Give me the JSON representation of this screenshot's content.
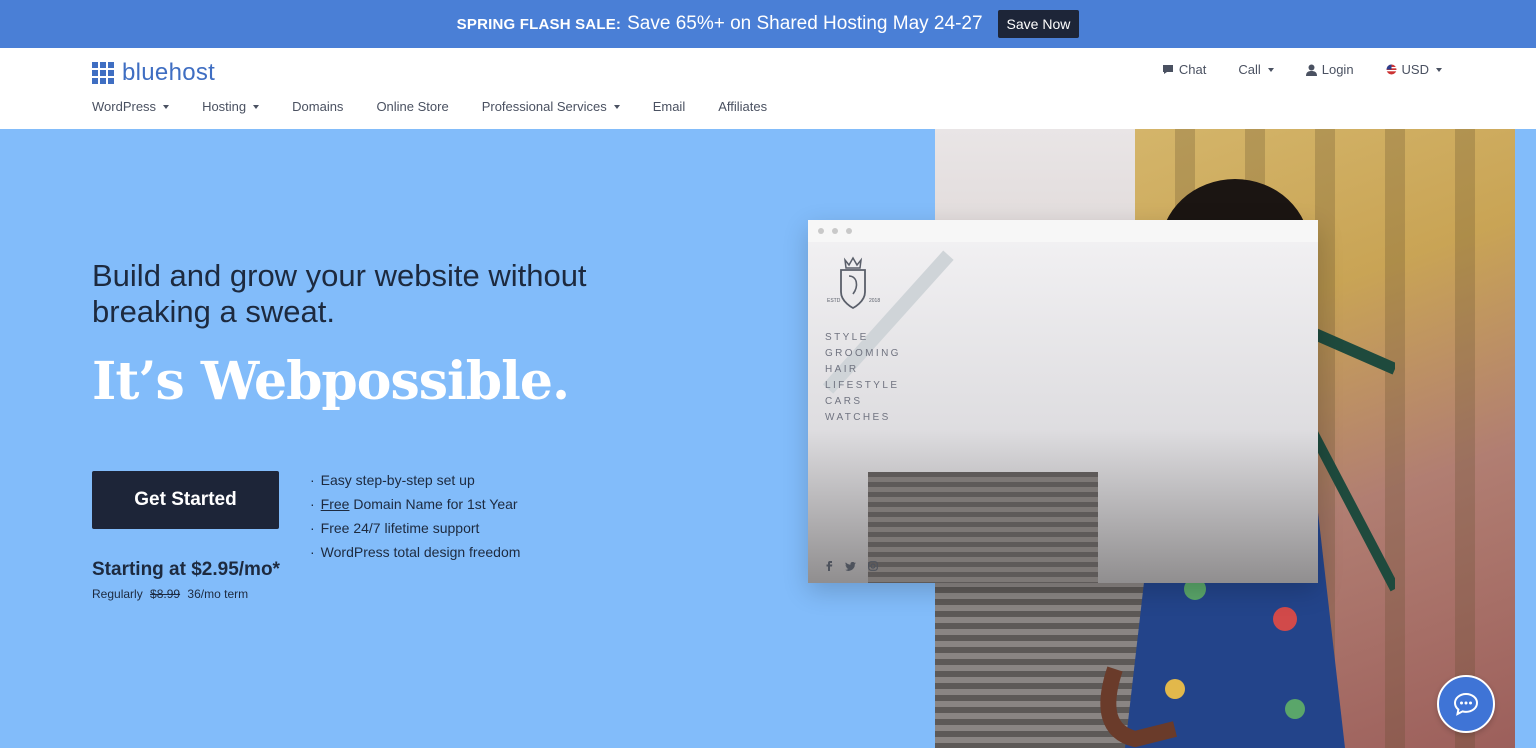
{
  "promo": {
    "lead": "SPRING FLASH SALE:",
    "offer": "Save 65%+ on Shared Hosting May 24-27",
    "button": "Save Now"
  },
  "header": {
    "brand": "bluehost",
    "nav": [
      {
        "label": "WordPress",
        "dropdown": true
      },
      {
        "label": "Hosting",
        "dropdown": true
      },
      {
        "label": "Domains",
        "dropdown": false
      },
      {
        "label": "Online Store",
        "dropdown": false
      },
      {
        "label": "Professional Services",
        "dropdown": true
      },
      {
        "label": "Email",
        "dropdown": false
      },
      {
        "label": "Affiliates",
        "dropdown": false
      }
    ],
    "utility": {
      "chat": "Chat",
      "call": "Call",
      "login": "Login",
      "currency": "USD"
    }
  },
  "hero": {
    "headline": "Build and grow your website without breaking a sweat.",
    "tagline": "It’s Webpossible.",
    "cta": "Get Started",
    "price": "Starting at $2.95/mo*",
    "regular_prefix": "Regularly",
    "regular_price": "$8.99",
    "regular_term": "36/mo term",
    "features": [
      {
        "prefix": "",
        "underlined": "",
        "text": "Easy step-by-step set up"
      },
      {
        "prefix": "",
        "underlined": "Free",
        "text": " Domain Name for 1st Year"
      },
      {
        "prefix": "",
        "underlined": "",
        "text": "Free 24/7 lifetime support"
      },
      {
        "prefix": "",
        "underlined": "",
        "text": "WordPress total design freedom"
      }
    ]
  },
  "mockup": {
    "logo_left": "ESTD",
    "logo_right": "2018",
    "menu": [
      "STYLE",
      "GROOMING",
      "HAIR",
      "LIFESTYLE",
      "CARS",
      "WATCHES"
    ],
    "social": [
      "facebook-icon",
      "twitter-icon",
      "instagram-icon"
    ]
  },
  "colors": {
    "promo_bg": "#4a7fd6",
    "hero_bg": "#82bcfa",
    "dark_navy": "#1d2538",
    "brand_blue": "#3f6ec2"
  }
}
